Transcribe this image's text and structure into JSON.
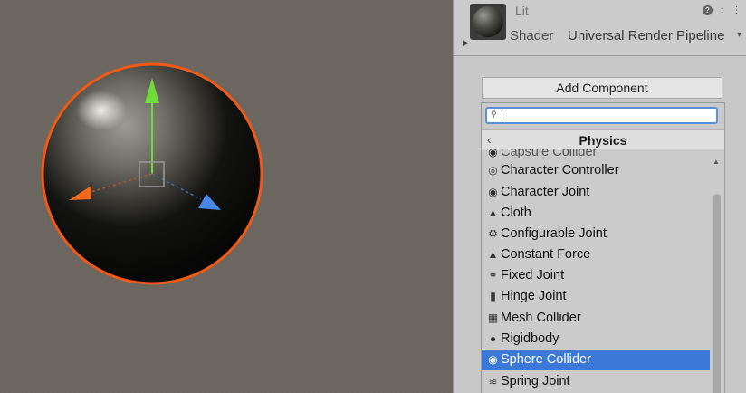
{
  "material": {
    "name": "Lit",
    "shader_label": "Shader",
    "shader_value": "Universal Render Pipeline"
  },
  "inspector": {
    "add_component_label": "Add Component"
  },
  "popup": {
    "search_value": "",
    "category_title": "Physics",
    "items": [
      {
        "label": "Capsule Collider",
        "icon": "capsule-collider-icon"
      },
      {
        "label": "Character Controller",
        "icon": "character-controller-icon"
      },
      {
        "label": "Character Joint",
        "icon": "character-joint-icon"
      },
      {
        "label": "Cloth",
        "icon": "cloth-icon"
      },
      {
        "label": "Configurable Joint",
        "icon": "configurable-joint-icon"
      },
      {
        "label": "Constant Force",
        "icon": "constant-force-icon"
      },
      {
        "label": "Fixed Joint",
        "icon": "fixed-joint-icon"
      },
      {
        "label": "Hinge Joint",
        "icon": "hinge-joint-icon"
      },
      {
        "label": "Mesh Collider",
        "icon": "mesh-collider-icon"
      },
      {
        "label": "Rigidbody",
        "icon": "rigidbody-icon"
      },
      {
        "label": "Sphere Collider",
        "icon": "sphere-collider-icon"
      },
      {
        "label": "Spring Joint",
        "icon": "spring-joint-icon"
      }
    ],
    "selected_item": "Sphere Collider"
  },
  "colors": {
    "selection": "#3b78d8",
    "scene_background": "#6b6660",
    "outline": "#f05a14",
    "gizmo_y": "#6fdc3a",
    "gizmo_x": "#ef6a1e",
    "gizmo_z": "#4a86e8"
  }
}
